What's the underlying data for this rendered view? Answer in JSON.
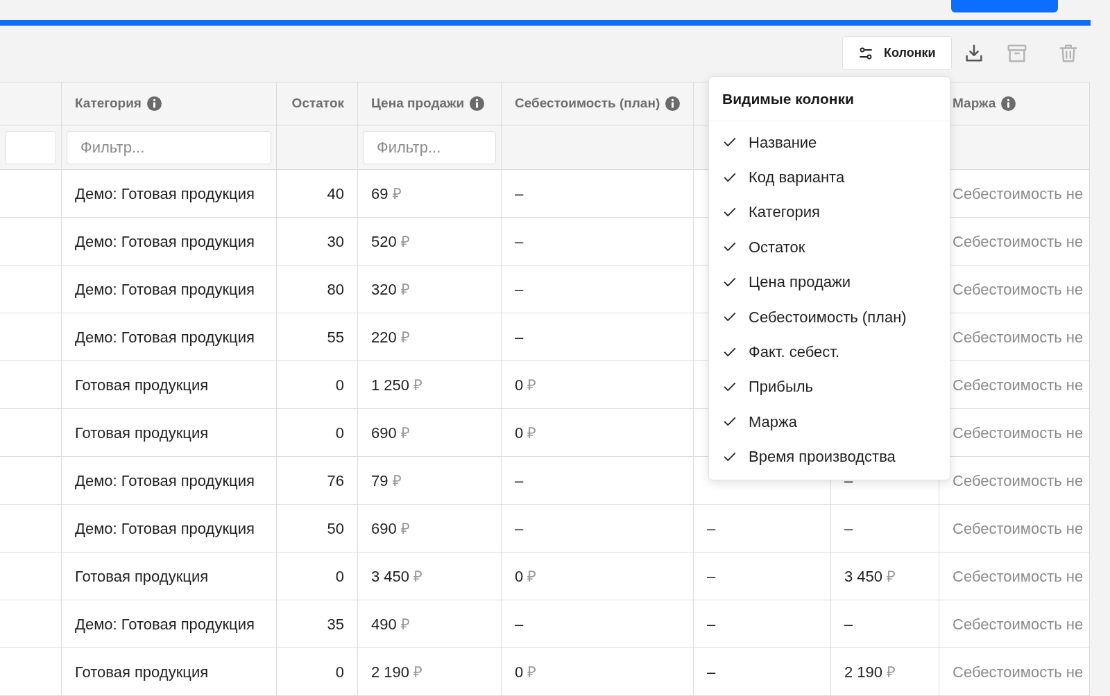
{
  "toolbar": {
    "columns_button": "Колонки",
    "actions": [
      {
        "kind": "download",
        "disabled": false
      },
      {
        "kind": "archive",
        "disabled": true
      },
      {
        "kind": "delete",
        "disabled": true
      }
    ]
  },
  "table": {
    "columns": [
      {
        "filter": true
      },
      {
        "label": "Категория",
        "info": true,
        "filter": true,
        "placeholder": "Фильтр..."
      },
      {
        "label": "Остаток",
        "info": false,
        "filter": false,
        "kind": "numeric"
      },
      {
        "label": "Цена продажи",
        "info": true,
        "filter": true,
        "placeholder": "Фильтр..."
      },
      {
        "label": "Себестоимость (план)",
        "info": true,
        "filter": false
      },
      {
        "kind": "hidden"
      },
      {
        "kind": "hidden"
      },
      {
        "label": "Маржа",
        "info": true
      }
    ],
    "rows": [
      {
        "cells": [
          null,
          "Демо: Готовая продукция",
          "40",
          {
            "amount": "69",
            "currency": "₽"
          },
          "–",
          null,
          null,
          {
            "muted": "Себестоимость не"
          }
        ]
      },
      {
        "cells": [
          null,
          "Демо: Готовая продукция",
          "30",
          {
            "amount": "520",
            "currency": "₽"
          },
          "–",
          null,
          null,
          {
            "muted": "Себестоимость не"
          }
        ]
      },
      {
        "cells": [
          null,
          "Демо: Готовая продукция",
          "80",
          {
            "amount": "320",
            "currency": "₽"
          },
          "–",
          null,
          null,
          {
            "muted": "Себестоимость не"
          }
        ]
      },
      {
        "cells": [
          null,
          "Демо: Готовая продукция",
          "55",
          {
            "amount": "220",
            "currency": "₽"
          },
          "–",
          null,
          null,
          {
            "muted": "Себестоимость не"
          }
        ]
      },
      {
        "cells": [
          null,
          "Готовая продукция",
          "0",
          {
            "amount": "1 250",
            "currency": "₽"
          },
          {
            "amount": "0",
            "currency": "₽"
          },
          null,
          null,
          {
            "muted": "Себестоимость не"
          }
        ]
      },
      {
        "cells": [
          null,
          "Готовая продукция",
          "0",
          {
            "amount": "690",
            "currency": "₽"
          },
          {
            "amount": "0",
            "currency": "₽"
          },
          null,
          null,
          {
            "muted": "Себестоимость не"
          }
        ]
      },
      {
        "cells": [
          null,
          "Демо: Готовая продукция",
          "76",
          {
            "amount": "79",
            "currency": "₽"
          },
          "–",
          null,
          "–",
          {
            "muted": "Себестоимость не"
          }
        ]
      },
      {
        "cells": [
          null,
          "Демо: Готовая продукция",
          "50",
          {
            "amount": "690",
            "currency": "₽"
          },
          "–",
          "–",
          "–",
          {
            "muted": "Себестоимость не"
          }
        ]
      },
      {
        "cells": [
          null,
          "Готовая продукция",
          "0",
          {
            "amount": "3 450",
            "currency": "₽"
          },
          {
            "amount": "0",
            "currency": "₽"
          },
          "–",
          {
            "amount": "3 450",
            "currency": "₽"
          },
          {
            "muted": "Себестоимость не"
          }
        ]
      },
      {
        "cells": [
          null,
          "Демо: Готовая продукция",
          "35",
          {
            "amount": "490",
            "currency": "₽"
          },
          "–",
          "–",
          "–",
          {
            "muted": "Себестоимость не"
          }
        ]
      },
      {
        "cells": [
          null,
          "Готовая продукция",
          "0",
          {
            "amount": "2 190",
            "currency": "₽"
          },
          {
            "amount": "0",
            "currency": "₽"
          },
          "–",
          {
            "amount": "2 190",
            "currency": "₽"
          },
          {
            "muted": "Себестоимость не"
          }
        ]
      }
    ]
  },
  "columns_menu": {
    "title": "Видимые колонки",
    "items": [
      {
        "label": "Название",
        "checked": true
      },
      {
        "label": "Код варианта",
        "checked": true
      },
      {
        "label": "Категория",
        "checked": true
      },
      {
        "label": "Остаток",
        "checked": true
      },
      {
        "label": "Цена продажи",
        "checked": true
      },
      {
        "label": "Себестоимость (план)",
        "checked": true
      },
      {
        "label": "Факт. себест.",
        "checked": true
      },
      {
        "label": "Прибыль",
        "checked": true
      },
      {
        "label": "Маржа",
        "checked": true
      },
      {
        "label": "Время производства",
        "checked": true
      }
    ]
  }
}
